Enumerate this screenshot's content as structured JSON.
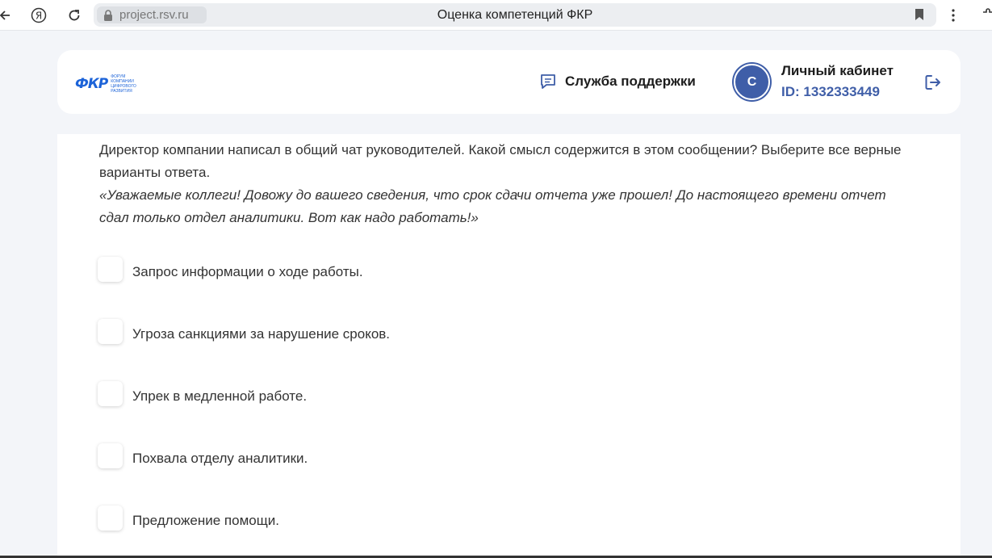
{
  "browser": {
    "url": "project.rsv.ru",
    "tab_title": "Оценка компетенций ФКР"
  },
  "header": {
    "logo_mark": "ФКР",
    "logo_sub": "ФОРУМ КОМПАНИИ ЦИФРОВОГО РАЗВИТИЯ",
    "support_label": "Служба поддержки",
    "avatar_letter": "С",
    "cabinet_title": "Личный кабинет",
    "cabinet_id": "ID: 1332333449"
  },
  "question": {
    "text": "Директор компании написал в общий чат руководителей. Какой смысл содержится в этом сообщении? Выберите все верные варианты ответа.",
    "quote": "«Уважаемые коллеги! Довожу до вашего сведения, что срок сдачи отчета уже прошел! До настоящего времени отчет сдал только отдел аналитики. Вот как надо работать!»"
  },
  "options": [
    {
      "label": "Запрос информации о ходе работы.",
      "checked": false
    },
    {
      "label": "Угроза санкциями за нарушение сроков.",
      "checked": false
    },
    {
      "label": "Упрек в медленной работе.",
      "checked": false
    },
    {
      "label": "Похвала отделу аналитики.",
      "checked": false
    },
    {
      "label": "Предложение помощи.",
      "checked": false
    }
  ],
  "colors": {
    "accent": "#3f5ea8",
    "logo": "#1c63d8",
    "background": "#f3f5f9"
  }
}
